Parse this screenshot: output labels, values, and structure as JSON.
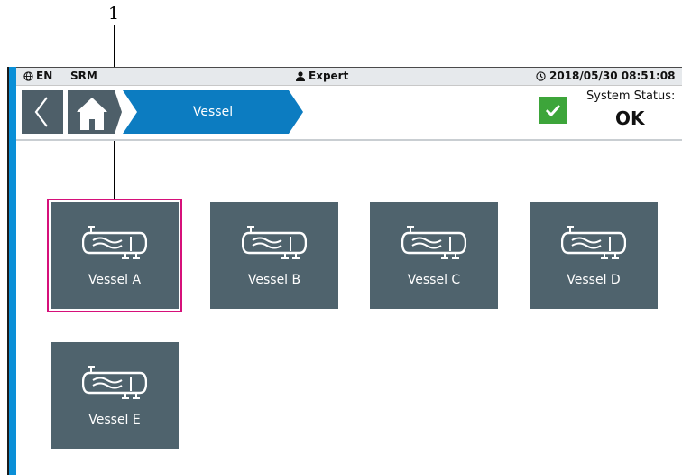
{
  "callout": {
    "number": "1"
  },
  "statusbar": {
    "language": "EN",
    "mode": "SRM",
    "user_role": "Expert",
    "datetime": "2018/05/30 08:51:08"
  },
  "navbar": {
    "breadcrumb_current": "Vessel",
    "system_status_label": "System Status:",
    "system_status_value": "OK"
  },
  "tiles": [
    {
      "label": "Vessel A",
      "selected": true
    },
    {
      "label": "Vessel B",
      "selected": false
    },
    {
      "label": "Vessel C",
      "selected": false
    },
    {
      "label": "Vessel D",
      "selected": false
    },
    {
      "label": "Vessel E",
      "selected": false
    }
  ],
  "colors": {
    "accent_blue": "#0a8fd7",
    "tile_bg": "#4f636d",
    "selection_border": "#d6107a",
    "status_ok": "#3da53a"
  }
}
